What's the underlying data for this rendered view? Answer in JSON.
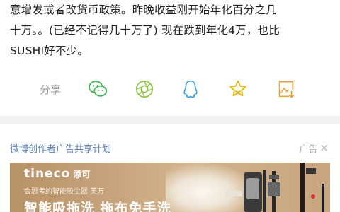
{
  "article": {
    "lines": [
      "意增发或者改货币政策。昨晚收益刚开始年化百分之几",
      "十万。。(已经不记得几十万了) 现在跌到年化4万，也比",
      "SUSHI好不少。"
    ]
  },
  "share": {
    "label": "分享",
    "icons": [
      "wechat-icon",
      "moments-icon",
      "qq-icon",
      "favorite-icon",
      "save-image-icon"
    ],
    "colors": {
      "green": "#39b54a",
      "lime": "#8cc63f",
      "blue": "#3aa0e0",
      "star": "#e8b400",
      "orange": "#f0a030"
    }
  },
  "ad": {
    "title": "微博创作者广告共享计划",
    "tag": "广告",
    "close_symbol": "×",
    "brand_name": "tineco",
    "brand_cn": "添可",
    "subtitle": "会思考的智能吸尘器 芙万",
    "headline": "智能吸拖洗  拖布免手洗"
  }
}
